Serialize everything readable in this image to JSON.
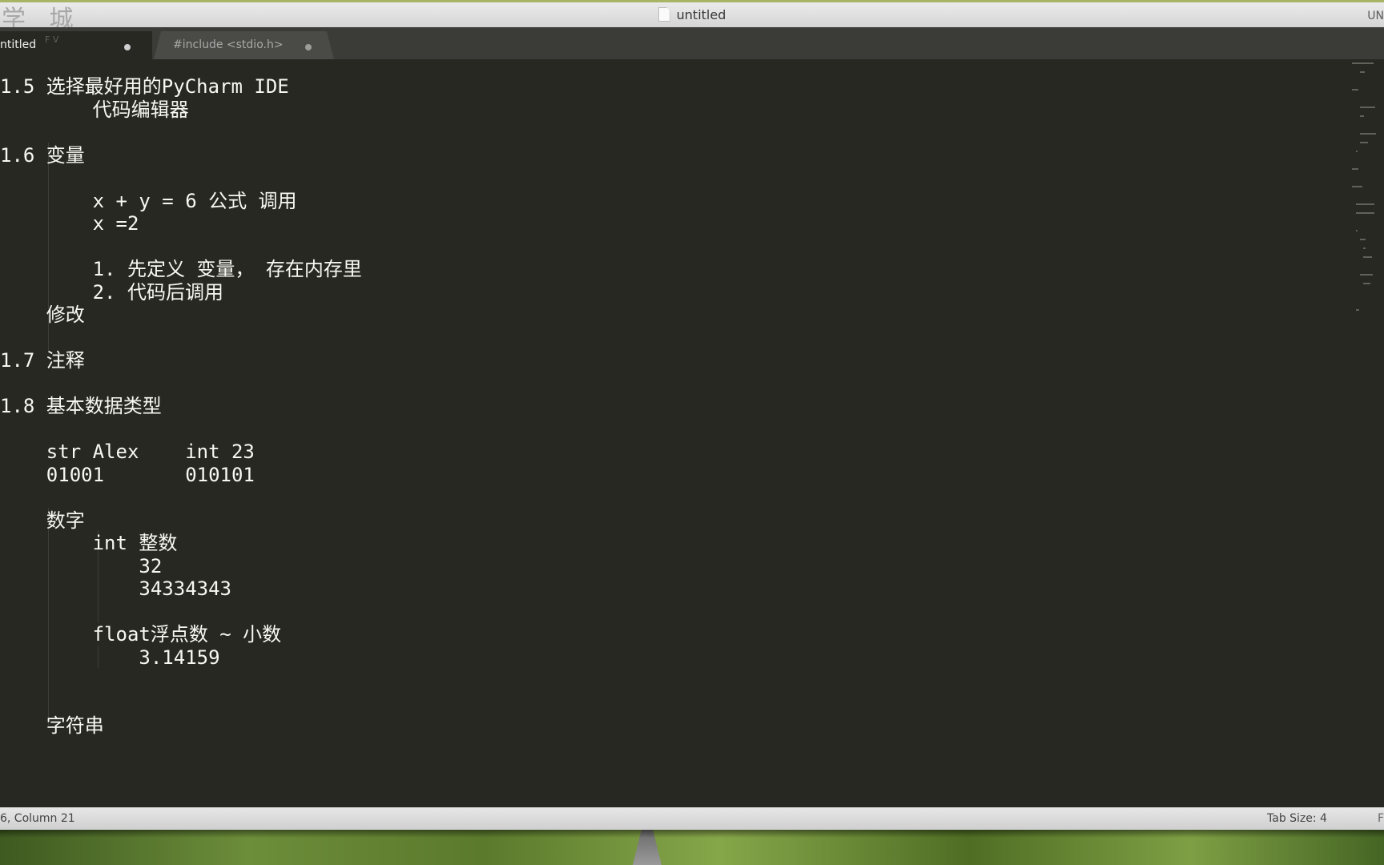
{
  "window": {
    "watermark": "学 城",
    "title": "untitled",
    "right_clip": "UN"
  },
  "tabs": [
    {
      "label": "ntitled",
      "active": true,
      "ghost_text": "F V"
    },
    {
      "label": "#include <stdio.h>",
      "active": false
    }
  ],
  "editor": {
    "lines": [
      "1.5 选择最好用的PyCharm IDE",
      "        代码编辑器",
      "",
      "1.6 变量",
      "",
      "        x + y = 6 公式 调用",
      "        x =2",
      "",
      "        1. 先定义 变量， 存在内存里",
      "        2. 代码后调用",
      "    修改",
      "",
      "1.7 注释",
      "",
      "1.8 基本数据类型",
      "",
      "    str Alex    int 23",
      "    01001       010101",
      "",
      "    数字",
      "        int 整数",
      "            32",
      "            34334343",
      "",
      "        float浮点数 ~ 小数",
      "            3.14159",
      "",
      "",
      "    字符串"
    ]
  },
  "statusbar": {
    "position": "6, Column 21",
    "tab_size": "Tab Size: 4",
    "edge": "F"
  }
}
